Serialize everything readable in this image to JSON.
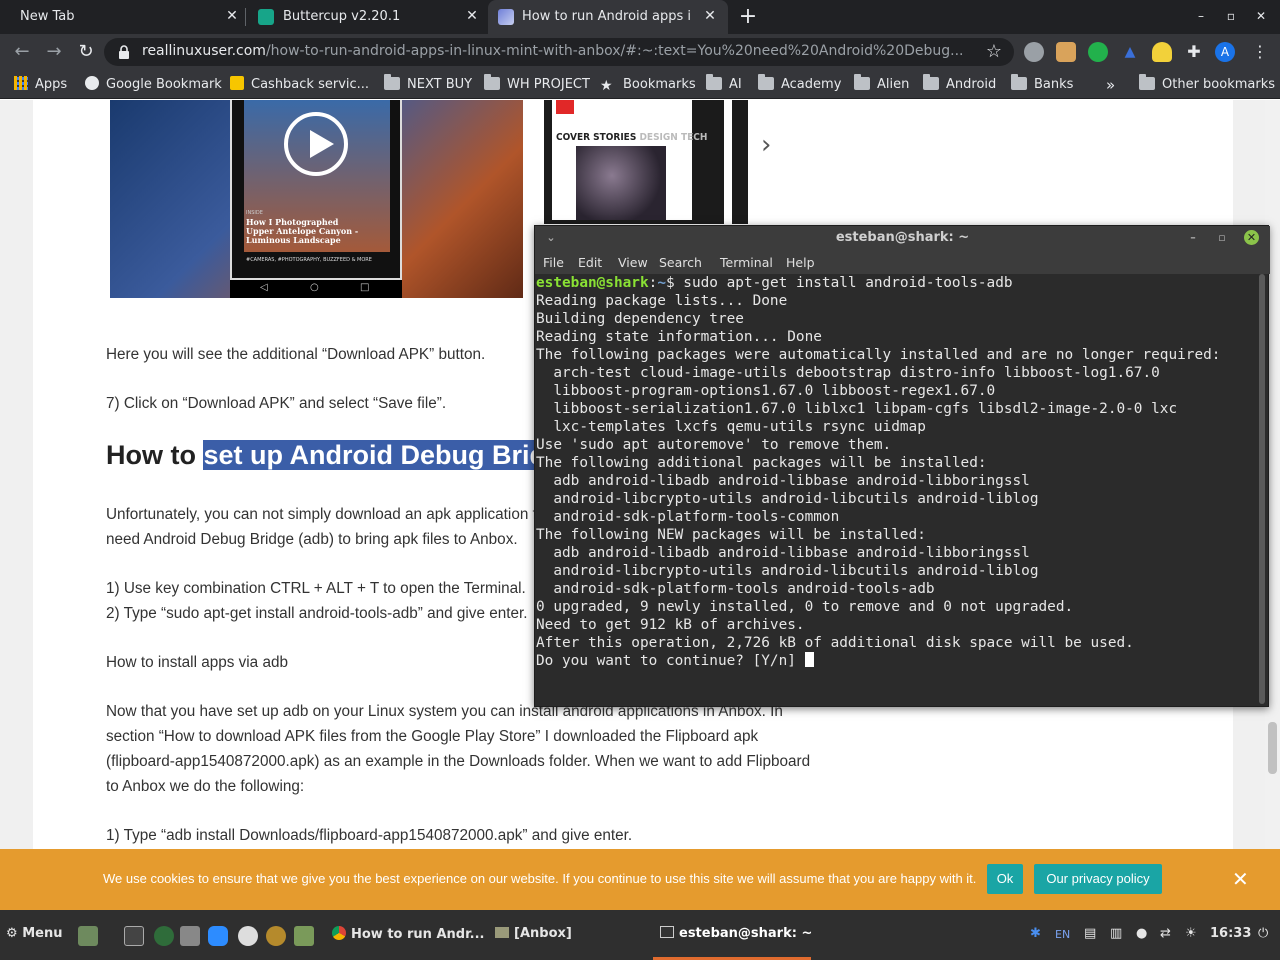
{
  "browser": {
    "tabs": [
      {
        "title": "New Tab",
        "close": "✕"
      },
      {
        "title": "Buttercup v2.20.1",
        "close": "✕"
      },
      {
        "title": "How to run Android apps in Linux",
        "close": "✕"
      }
    ],
    "new_tab": "+",
    "window_controls": {
      "minimize": "–",
      "maximize": "▫",
      "close": "✕"
    },
    "url_host": "reallinuxuser.com",
    "url_path": "/how-to-run-android-apps-in-linux-mint-with-anbox/#:~:text=You%20need%20Android%20Debug...",
    "avatar_letter": "A"
  },
  "bookmarks": {
    "apps": "Apps",
    "items": [
      "Google Bookmark",
      "Cashback servic...",
      "NEXT BUY",
      "WH PROJECT",
      "Bookmarks",
      "AI",
      "Academy",
      "Alien",
      "Android",
      "Banks"
    ],
    "overflow": "»",
    "other": "Other bookmarks"
  },
  "article": {
    "phone_caption": "How I Photographed Upper Antelope Canyon - Luminous Landscape",
    "phone_inside": "INSIDE",
    "phone_tags": "#CAMERAS, #PHOTOGRAPHY, BUZZFEED & MORE",
    "mag_cover": "COVER STORIES",
    "mag_cover_dim": "DESIGN TECH",
    "p1": "Here you will see the additional “Download APK” button.",
    "p2": "7) Click on “Download APK” and select “Save file”.",
    "heading_prefix": "How to ",
    "heading_highlight": "set up Android Debug Bridge",
    "p3_line1": "Unfortunately, you can not simply download an apk application file",
    "p3_line2": "need Android Debug Bridge (adb) to bring apk files to Anbox.",
    "p4": "1) Use key combination CTRL + ALT + T to open the Terminal.",
    "p5": "2) Type “sudo apt-get install android-tools-adb” and give enter.",
    "p6": "How to install apps via adb",
    "p7_lines": [
      "Now that you have set up adb on your Linux system you can install android applications in Anbox. In",
      "section “How to download APK files from the Google Play Store” I downloaded the Flipboard apk",
      "(flipboard-app1540872000.apk) as an example in the Downloads folder. When we want to add Flipboard",
      "to Anbox we do the following:"
    ],
    "p8": "1) Type “adb install Downloads/flipboard-app1540872000.apk” and give enter."
  },
  "cookie": {
    "text": "We use cookies to ensure that we give you the best experience on our website. If you continue to use this site we will assume that you are happy with it.",
    "ok": "Ok",
    "privacy": "Our privacy policy",
    "close": "✕"
  },
  "terminal": {
    "title": "esteban@shark: ~",
    "menu": [
      "File",
      "Edit",
      "View",
      "Search",
      "Terminal",
      "Help"
    ],
    "prompt_user": "esteban@shark",
    "prompt_sep": ":",
    "prompt_path": "~",
    "command": "$ sudo apt-get install android-tools-adb",
    "lines": [
      "Reading package lists... Done",
      "Building dependency tree",
      "Reading state information... Done",
      "The following packages were automatically installed and are no longer required:",
      "  arch-test cloud-image-utils debootstrap distro-info libboost-log1.67.0",
      "  libboost-program-options1.67.0 libboost-regex1.67.0",
      "  libboost-serialization1.67.0 liblxc1 libpam-cgfs libsdl2-image-2.0-0 lxc",
      "  lxc-templates lxcfs qemu-utils rsync uidmap",
      "Use 'sudo apt autoremove' to remove them.",
      "The following additional packages will be installed:",
      "  adb android-libadb android-libbase android-libboringssl",
      "  android-libcrypto-utils android-libcutils android-liblog",
      "  android-sdk-platform-tools-common",
      "The following NEW packages will be installed:",
      "  adb android-libadb android-libbase android-libboringssl",
      "  android-libcrypto-utils android-libcutils android-liblog",
      "  android-sdk-platform-tools android-tools-adb",
      "0 upgraded, 9 newly installed, 0 to remove and 0 not upgraded.",
      "Need to get 912 kB of archives.",
      "After this operation, 2,726 kB of additional disk space will be used."
    ],
    "last_line": "Do you want to continue? [Y/n] "
  },
  "taskbar": {
    "menu": "Menu",
    "tasks": [
      "How to run Andr...",
      "[Anbox]",
      "esteban@shark: ~"
    ],
    "lang": "EN",
    "clock": "16:33"
  }
}
